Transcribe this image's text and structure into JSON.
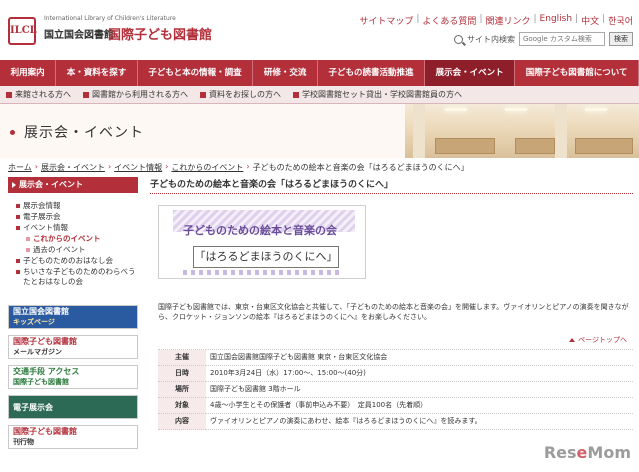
{
  "header": {
    "logo_mark": "ILCL",
    "logo_en": "International Library of Children's Literature",
    "logo_ndl": "国立国会図書館",
    "logo_ilcl": "国際子ども図書館"
  },
  "util_links": [
    "サイトマップ",
    "よくある質問",
    "関連リンク",
    "English",
    "中文",
    "한국어"
  ],
  "search": {
    "label": "サイト内検索",
    "placeholder": "Google カスタム検索",
    "button": "検索"
  },
  "main_nav": [
    {
      "label": "利用案内",
      "active": false
    },
    {
      "label": "本・資料を探す",
      "active": false
    },
    {
      "label": "子どもと本の情報・調査",
      "active": false
    },
    {
      "label": "研修・交流",
      "active": false
    },
    {
      "label": "子どもの読書活動推進",
      "active": false
    },
    {
      "label": "展示会・イベント",
      "active": true
    },
    {
      "label": "国際子ども図書館について",
      "active": false
    }
  ],
  "sub_nav": [
    "来館される方へ",
    "図書館から利用される方へ",
    "資料をお探しの方へ",
    "学校図書館セット貸出・学校図書館員の方へ"
  ],
  "banner": {
    "title": "展示会・イベント"
  },
  "breadcrumb": [
    "ホーム",
    "展示会・イベント",
    "イベント情報",
    "これからのイベント",
    "子どものための絵本と音楽の会「はろるどまほうのくにへ」"
  ],
  "sidebar": {
    "header": "展示会・イベント",
    "items": [
      {
        "label": "展示会情報",
        "child": false,
        "strong": false
      },
      {
        "label": "電子展示会",
        "child": false,
        "strong": false
      },
      {
        "label": "イベント情報",
        "child": false,
        "strong": false
      },
      {
        "label": "これからのイベント",
        "child": true,
        "strong": true
      },
      {
        "label": "過去のイベント",
        "child": true,
        "strong": false
      },
      {
        "label": "子どものためのおはなし会",
        "child": false,
        "strong": false
      },
      {
        "label": "ちいさな子どものためのわらべうたとおはなしの会",
        "child": false,
        "strong": false
      }
    ],
    "banners": {
      "ndl_title": "国立国会図書館",
      "ndl_sub": "キッズページ",
      "mail_title": "国際子ども図書館",
      "mail_sub": "メールマガジン",
      "access_title": "交通手段 アクセス",
      "access_sub": "国際子ども図書館",
      "exhibition": "電子展示会",
      "pub_title": "国際子ども図書館",
      "pub_sub": "刊行物"
    }
  },
  "content": {
    "heading": "子どものための絵本と音楽の会「はろるどまほうのくにへ」",
    "poster_title1": "子どものための絵本と音楽の会",
    "poster_title2": "「はろるどまほうのくにへ」",
    "intro": "国際子ども図書館では、東京・台東区文化協会と共催して、「子どものための絵本と音楽の会」を開催します。ヴァイオリンとピアノの演奏を聞きながら、クロケット・ジョンソンの絵本『はろるどまほうのくにへ』をお楽しみください。",
    "pagetop": "ページトップへ",
    "table": [
      {
        "label": "主催",
        "value": "国立国会図書館国際子ども図書館 東京・台東区文化協会"
      },
      {
        "label": "日時",
        "value": "2010年3月24日（水）17:00～、15:00～(40分)"
      },
      {
        "label": "場所",
        "value": "国際子ども図書館 3階ホール"
      },
      {
        "label": "対象",
        "value": "4歳～小学生とその保護者（事前申込み不要）　定員100名（先着順）"
      },
      {
        "label": "内容",
        "value": "ヴァイオリンとピアノの演奏にあわせ、絵本『はろるどまほうのくにへ』を読みます。"
      }
    ]
  },
  "watermark": {
    "brand_left": "Res",
    "brand_e": "e",
    "brand_right": "Mom"
  },
  "colors": {
    "brand": "#b3303b",
    "nav_active": "#8e1e29"
  }
}
